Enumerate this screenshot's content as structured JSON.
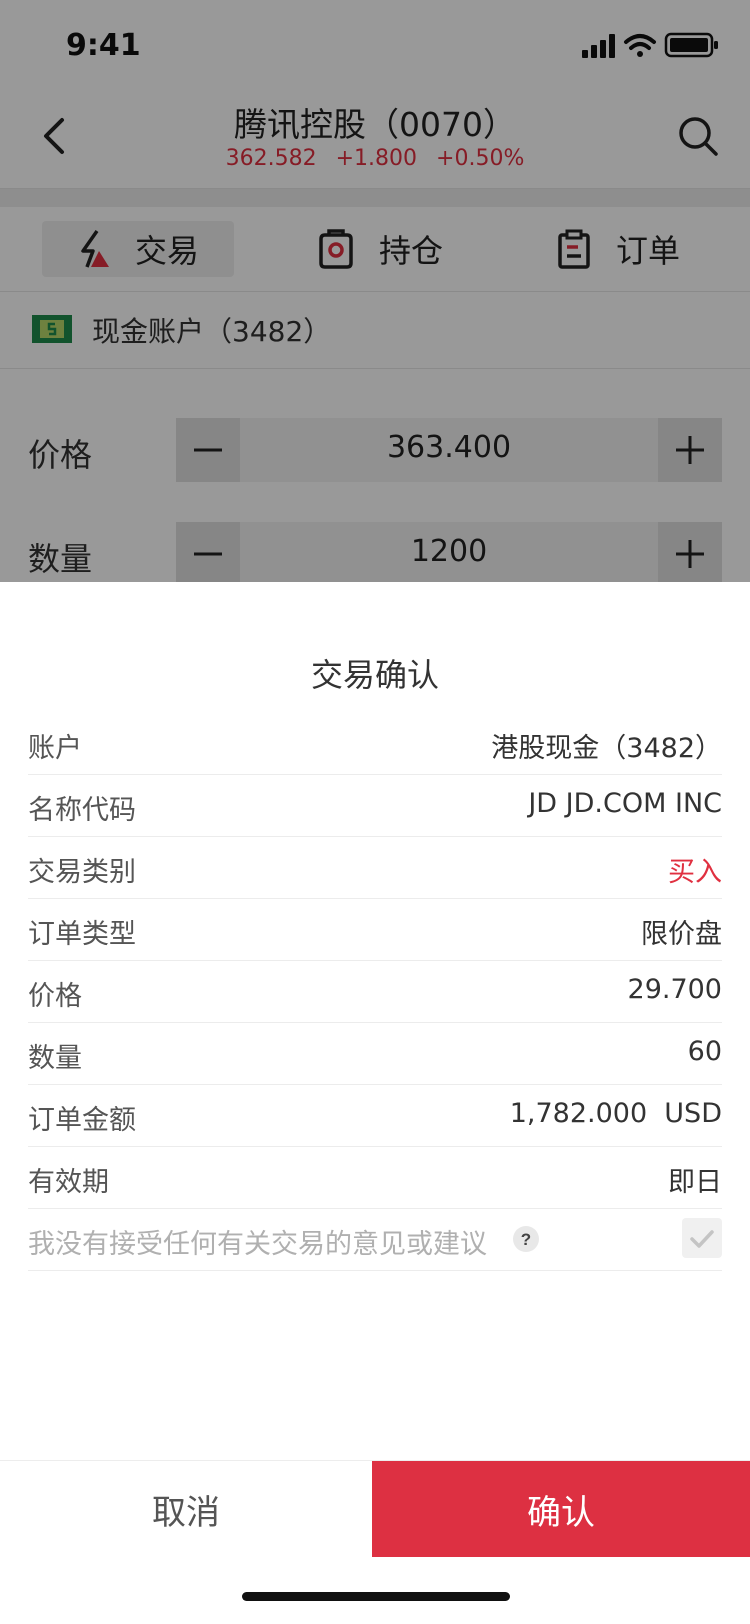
{
  "status_bar": {
    "time": "9:41"
  },
  "header": {
    "title": "腾讯控股（0070）",
    "price": "362.582",
    "change": "+1.800",
    "change_pct": "+0.50%"
  },
  "tabs": [
    {
      "label": "交易",
      "icon": "lightning-icon"
    },
    {
      "label": "持仓",
      "icon": "position-icon"
    },
    {
      "label": "订单",
      "icon": "clipboard-icon"
    }
  ],
  "account": {
    "label": "现金账户（3482）",
    "icon": "cash-account-icon"
  },
  "order_form": {
    "price_label": "价格",
    "price_value": "363.400",
    "quantity_label": "数量",
    "quantity_value": "1200"
  },
  "confirm_sheet": {
    "title": "交易确认",
    "rows": [
      {
        "label": "账户",
        "value": "港股现金（3482）"
      },
      {
        "label": "名称代码",
        "value": "JD JD.COM INC"
      },
      {
        "label": "交易类别",
        "value": "买入"
      },
      {
        "label": "订单类型",
        "value": "限价盘"
      },
      {
        "label": "价格",
        "value": "29.700"
      },
      {
        "label": "数量",
        "value": "60"
      },
      {
        "label": "订单金额",
        "value": "1,782.000  USD"
      },
      {
        "label": "有效期",
        "value": "即日"
      }
    ],
    "disclaimer": "我没有接受任何有关交易的意见或建议",
    "help_symbol": "?",
    "cancel_label": "取消",
    "confirm_label": "确认"
  },
  "colors": {
    "accent": "#e03040",
    "confirm_button": "#dd3042"
  }
}
